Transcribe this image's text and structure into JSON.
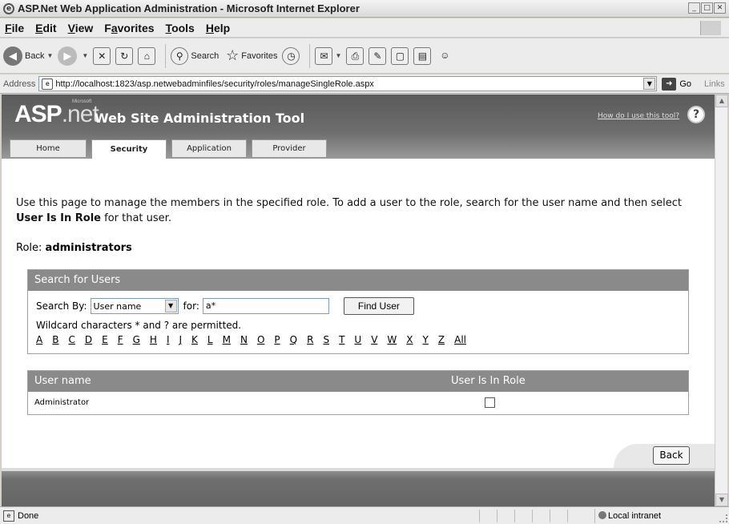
{
  "window": {
    "title": "ASP.Net Web Application Administration - Microsoft Internet Explorer"
  },
  "menu": {
    "items": [
      {
        "first": "F",
        "rest": "ile"
      },
      {
        "first": "E",
        "rest": "dit"
      },
      {
        "first": "V",
        "rest": "iew"
      },
      {
        "pre": "F",
        "first": "a",
        "rest": "vorites"
      },
      {
        "first": "T",
        "rest": "ools"
      },
      {
        "first": "H",
        "rest": "elp"
      }
    ]
  },
  "toolbar": {
    "back_label": "Back",
    "search_label": "Search",
    "favorites_label": "Favorites"
  },
  "address": {
    "label": "Address",
    "url": "http://localhost:1823/asp.netwebadminfiles/security/roles/manageSingleRole.aspx",
    "go_label": "Go",
    "links_label": "Links"
  },
  "header": {
    "logo_asp": "ASP",
    "logo_net": ".net",
    "logo_ms": "Microsoft",
    "title": "Web Site Administration Tool",
    "help_link": "How do I use this tool?",
    "tabs": [
      "Home",
      "Security",
      "Application",
      "Provider"
    ]
  },
  "intro": {
    "text1": "Use this page to manage the members in the specified role. To add a user to the role, search for the user name and then select ",
    "bold": "User Is In Role",
    "text2": " for that user."
  },
  "role": {
    "label": "Role:",
    "name": "administrators"
  },
  "search": {
    "title": "Search for Users",
    "search_by_label": "Search By:",
    "search_by_value": "User name",
    "for_label": "for:",
    "for_value": "a*",
    "find_button": "Find User",
    "hint": "Wildcard characters * and ? are permitted.",
    "letters": [
      "A",
      "B",
      "C",
      "D",
      "E",
      "F",
      "G",
      "H",
      "I",
      "J",
      "K",
      "L",
      "M",
      "N",
      "O",
      "P",
      "Q",
      "R",
      "S",
      "T",
      "U",
      "V",
      "W",
      "X",
      "Y",
      "Z",
      "All"
    ]
  },
  "users_table": {
    "col_user": "User name",
    "col_inrole": "User Is In Role",
    "rows": [
      {
        "user": "Administrator",
        "in_role": false
      }
    ]
  },
  "back_button": "Back",
  "status": {
    "text": "Done",
    "zone": "Local intranet"
  }
}
